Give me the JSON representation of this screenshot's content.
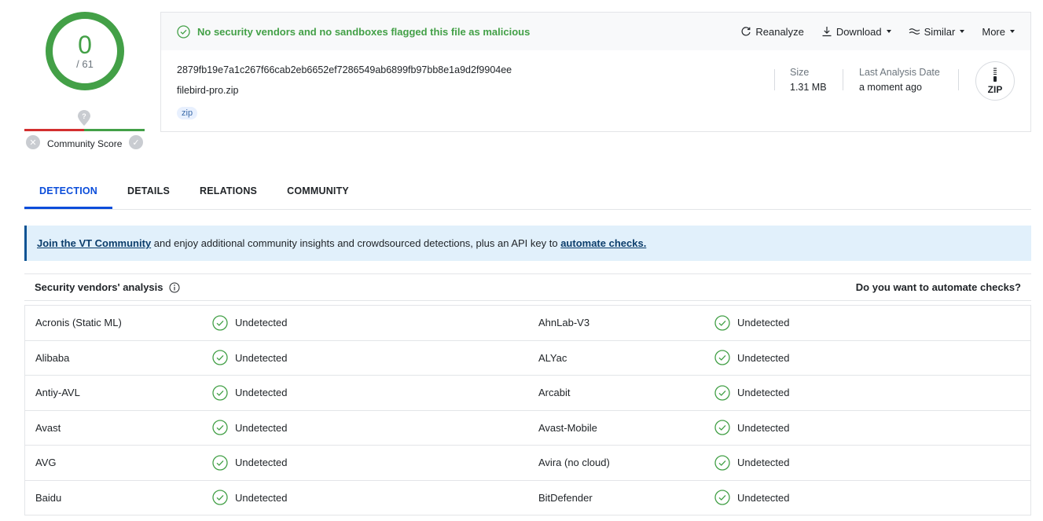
{
  "score": {
    "detections": "0",
    "total": "/ 61",
    "community_label": "Community Score"
  },
  "summary": {
    "banner": "No security vendors and no sandboxes flagged this file as malicious",
    "actions": {
      "reanalyze": "Reanalyze",
      "download": "Download",
      "similar": "Similar",
      "more": "More"
    },
    "hash": "2879fb19e7a1c267f66cab2eb6652ef7286549ab6899fb97bb8e1a9d2f9904ee",
    "filename": "filebird-pro.zip",
    "tag": "zip",
    "size_label": "Size",
    "size_value": "1.31 MB",
    "date_label": "Last Analysis Date",
    "date_value": "a moment ago",
    "filetype_icon_label": "ZIP"
  },
  "tabs": [
    "DETECTION",
    "DETAILS",
    "RELATIONS",
    "COMMUNITY"
  ],
  "info": {
    "link1": "Join the VT Community",
    "text": " and enjoy additional community insights and crowdsourced detections, plus an API key to ",
    "link2": "automate checks."
  },
  "vendors_header": {
    "title": "Security vendors' analysis",
    "right": "Do you want to automate checks?"
  },
  "vendors": [
    {
      "left": "Acronis (Static ML)",
      "left_result": "Undetected",
      "right": "AhnLab-V3",
      "right_result": "Undetected"
    },
    {
      "left": "Alibaba",
      "left_result": "Undetected",
      "right": "ALYac",
      "right_result": "Undetected"
    },
    {
      "left": "Antiy-AVL",
      "left_result": "Undetected",
      "right": "Arcabit",
      "right_result": "Undetected"
    },
    {
      "left": "Avast",
      "left_result": "Undetected",
      "right": "Avast-Mobile",
      "right_result": "Undetected"
    },
    {
      "left": "AVG",
      "left_result": "Undetected",
      "right": "Avira (no cloud)",
      "right_result": "Undetected"
    },
    {
      "left": "Baidu",
      "left_result": "Undetected",
      "right": "BitDefender",
      "right_result": "Undetected"
    }
  ],
  "colors": {
    "clean": "#43a047",
    "accent": "#0b4dda",
    "malicious": "#d32f2f"
  }
}
